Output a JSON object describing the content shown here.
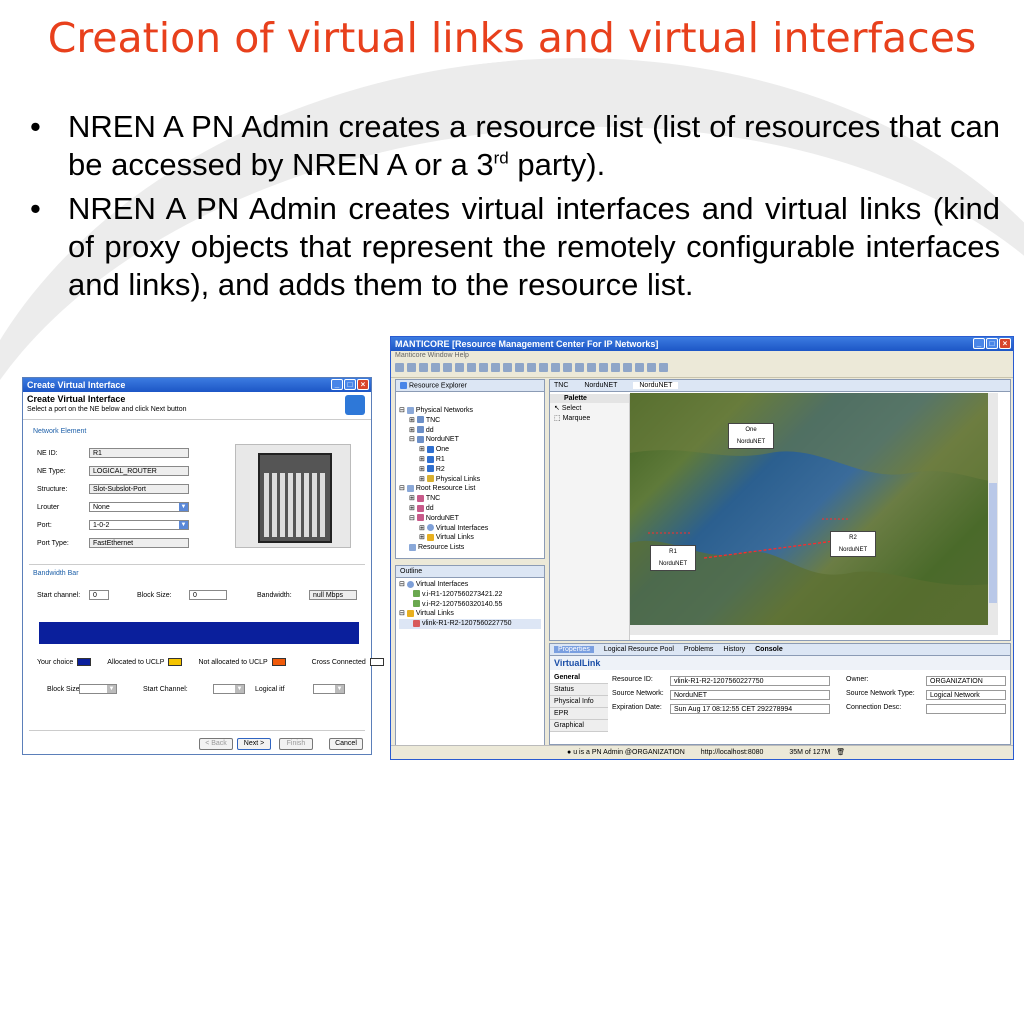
{
  "slide": {
    "title": "Creation of virtual links and virtual interfaces",
    "bullet1_pre": "NREN A PN Admin creates a resource list (list of resources that can be accessed by NREN A or a 3",
    "bullet1_sup": "rd",
    "bullet1_post": " party).",
    "bullet2": "NREN A PN Admin creates virtual interfaces and virtual links (kind of proxy objects that represent the remotely configurable interfaces and links), and adds them to the resource list."
  },
  "dialog": {
    "window_title": "Create Virtual Interface",
    "header_title": "Create Virtual Interface",
    "header_sub": "Select a port on the NE below and click Next button",
    "section_network": "Network Element",
    "ne_id_label": "NE ID:",
    "ne_id": "R1",
    "ne_type_label": "NE Type:",
    "ne_type": "LOGICAL_ROUTER",
    "structure_label": "Structure:",
    "structure": "Slot-Subslot-Port",
    "lrouter_label": "Lrouter",
    "lrouter": "None",
    "port_label": "Port:",
    "port": "1-0-2",
    "port_type_label": "Port Type:",
    "port_type": "FastEthernet",
    "section_bandwidth": "Bandwidth Bar",
    "start_channel_label": "Start channel:",
    "start_channel": "0",
    "block_size_label": "Block Size:",
    "block_size": "0",
    "bandwidth_label": "Bandwidth:",
    "bandwidth": "null Mbps",
    "legend_your_choice": "Your choice",
    "legend_allocated": "Allocated to UCLP",
    "legend_not_allocated": "Not allocated to UCLP",
    "legend_cross": "Cross Connected",
    "bottom_block_size": "Block Size:",
    "bottom_start_channel": "Start Channel:",
    "bottom_logical_itf": "Logical itf",
    "btn_back": "< Back",
    "btn_next": "Next >",
    "btn_finish": "Finish",
    "btn_cancel": "Cancel",
    "colors": {
      "your_choice": "#0a1f9c",
      "allocated": "#f5c400",
      "not_allocated": "#f05a0a",
      "cross": "#ffffff",
      "bar": "#0a1f9c"
    }
  },
  "manticore": {
    "window_title": "MANTICORE [Resource Management Center For IP Networks]",
    "menu": "Manticore  Window  Help",
    "explorer_tab": "Resource Explorer",
    "tree": [
      "Physical Networks",
      "TNC",
      "dd",
      "NorduNET",
      "One",
      "R1",
      "R2",
      "Physical Links",
      "Root Resource List",
      "TNC",
      "dd",
      "NorduNET",
      "Virtual Interfaces",
      "Virtual Links",
      "Resource Lists"
    ],
    "outline_tab": "Outline",
    "outline": [
      "Virtual Interfaces",
      "v.i-R1-1207560273421.22",
      "v.i-R2-1207560320140.55",
      "Virtual Links",
      "vlink-R1-R2-1207560227750"
    ],
    "editor_tabs": [
      "TNC",
      "NorduNET",
      "NorduNET"
    ],
    "palette_title": "Palette",
    "palette_select": "Select",
    "palette_marquee": "Marquee",
    "nodes": {
      "one_name": "One",
      "one_net": "NorduNET",
      "r1_name": "R1",
      "r1_net": "NorduNET",
      "r2_name": "R2",
      "r2_net": "NorduNET"
    },
    "props_tabs": [
      "Properties",
      "Logical Resource Pool",
      "Problems",
      "History",
      "Console"
    ],
    "props_title": "VirtualLink",
    "side_tabs": [
      "General",
      "Status",
      "Physical Info",
      "EPR",
      "Graphical"
    ],
    "resource_id_label": "Resource ID:",
    "resource_id": "vlink-R1-R2-1207560227750",
    "source_network_label": "Source Network:",
    "source_network": "NorduNET",
    "expiration_label": "Expiration Date:",
    "expiration": "Sun Aug 17 08:12:55 CET 292278994",
    "owner_label": "Owner:",
    "owner": "ORGANIZATION",
    "source_network_type_label": "Source Network Type:",
    "source_network_type": "Logical Network",
    "connection_desc_label": "Connection Desc:",
    "status_user": "u is a PN Admin @ORGANIZATION",
    "status_url": "http://localhost:8080",
    "status_mem": "35M of 127M"
  }
}
